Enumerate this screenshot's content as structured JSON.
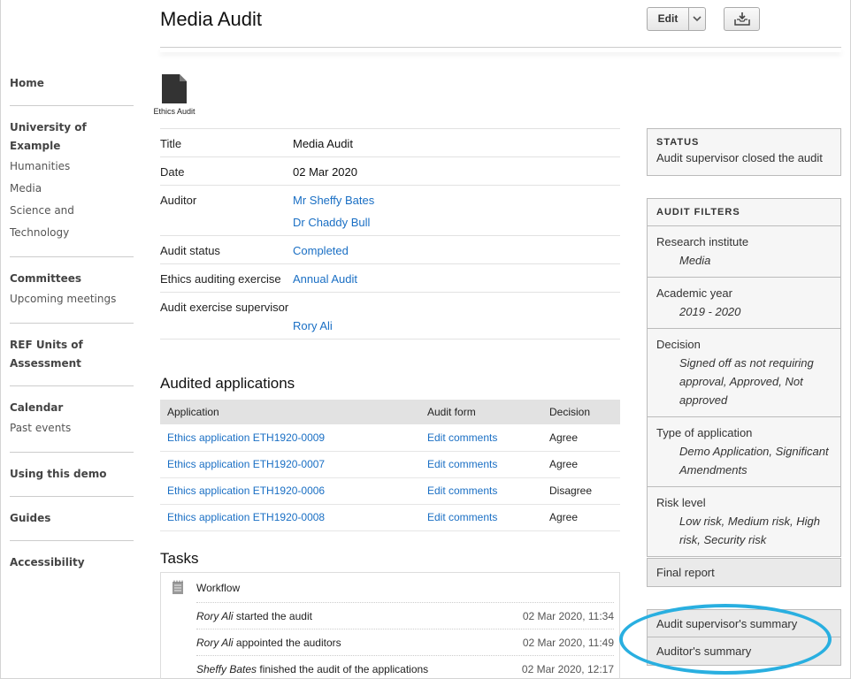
{
  "header": {
    "title": "Media Audit",
    "edit_label": "Edit"
  },
  "doc": {
    "caption": "Ethics Audit"
  },
  "sidebar": {
    "sections": [
      {
        "head": "Home",
        "links": []
      },
      {
        "head": "University of Example",
        "links": [
          "Humanities",
          "Media",
          "Science and Technology"
        ]
      },
      {
        "head": "Committees",
        "links": [
          "Upcoming meetings"
        ]
      },
      {
        "head": "REF Units of Assessment",
        "links": []
      },
      {
        "head": "Calendar",
        "links": [
          "Past events"
        ]
      },
      {
        "head": "Using this demo",
        "links": []
      },
      {
        "head": "Guides",
        "links": []
      },
      {
        "head": "Accessibility",
        "links": []
      }
    ]
  },
  "details": {
    "title_label": "Title",
    "title_value": "Media Audit",
    "date_label": "Date",
    "date_value": "02 Mar 2020",
    "auditor_label": "Auditor",
    "auditors": [
      "Mr Sheffy Bates",
      "Dr Chaddy Bull"
    ],
    "status_label": "Audit status",
    "status_value": "Completed",
    "exercise_label": "Ethics auditing exercise",
    "exercise_value": "Annual Audit",
    "supervisor_label": "Audit exercise supervisor",
    "supervisor_value": "Rory Ali"
  },
  "applications": {
    "heading": "Audited applications",
    "columns": [
      "Application",
      "Audit form",
      "Decision"
    ],
    "rows": [
      {
        "app": "Ethics application ETH1920-0009",
        "form": "Edit comments",
        "decision": "Agree"
      },
      {
        "app": "Ethics application ETH1920-0007",
        "form": "Edit comments",
        "decision": "Agree"
      },
      {
        "app": "Ethics application ETH1920-0006",
        "form": "Edit comments",
        "decision": "Disagree"
      },
      {
        "app": "Ethics application ETH1920-0008",
        "form": "Edit comments",
        "decision": "Agree"
      }
    ]
  },
  "tasks": {
    "heading": "Tasks",
    "workflow_label": "Workflow",
    "rows": [
      {
        "who": "Rory Ali",
        "what": " started the audit",
        "when": "02 Mar 2020, 11:34"
      },
      {
        "who": "Rory Ali",
        "what": " appointed the auditors",
        "when": "02 Mar 2020, 11:49"
      },
      {
        "who": "Sheffy Bates",
        "what": " finished the audit of the applications",
        "when": "02 Mar 2020, 12:17"
      }
    ]
  },
  "status": {
    "heading": "STATUS",
    "text": "Audit supervisor closed the audit"
  },
  "filters": {
    "heading": "AUDIT FILTERS",
    "items": [
      {
        "label": "Research institute",
        "value": "Media"
      },
      {
        "label": "Academic year",
        "value": "2019 - 2020"
      },
      {
        "label": "Decision",
        "value": "Signed off as not requiring approval, Approved, Not approved"
      },
      {
        "label": "Type of application",
        "value": "Demo Application, Significant Amendments"
      },
      {
        "label": "Risk level",
        "value": "Low risk, Medium risk, High risk, Security risk"
      }
    ]
  },
  "reports": {
    "final": "Final report",
    "supervisor_summary": "Audit supervisor's summary",
    "auditor_summary": "Auditor's summary"
  },
  "colors": {
    "link": "#1a6fc4",
    "highlight": "#29afe0"
  }
}
